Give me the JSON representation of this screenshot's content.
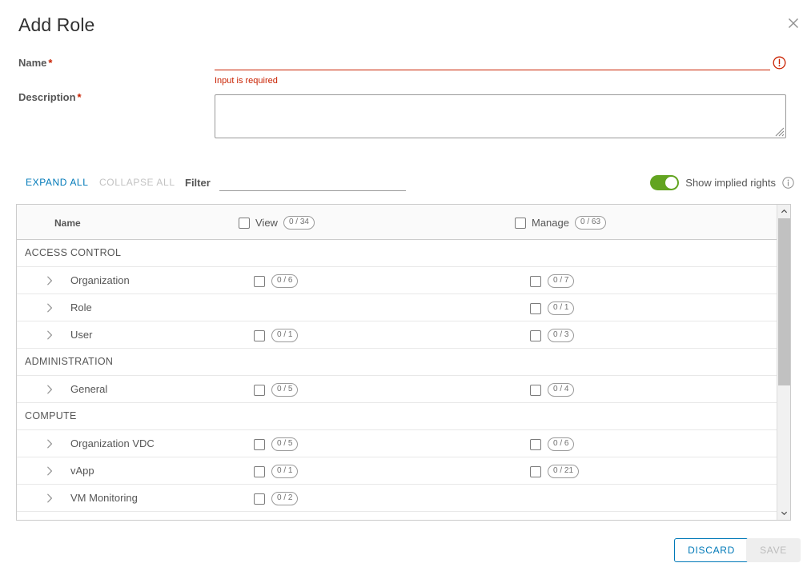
{
  "modal": {
    "title": "Add Role",
    "close_icon": "close-icon"
  },
  "form": {
    "name": {
      "label": "Name",
      "required_mark": "*",
      "value": "",
      "placeholder": "",
      "error_message": "Input is required",
      "error_icon": "exclamation-circle-icon",
      "error_color": "#c92100"
    },
    "description": {
      "label": "Description",
      "required_mark": "*",
      "value": "",
      "placeholder": ""
    }
  },
  "toolbar": {
    "expand_all_label": "EXPAND ALL",
    "collapse_all_label": "COLLAPSE ALL",
    "filter_label": "Filter",
    "filter_value": "",
    "filter_placeholder": "",
    "show_implied_rights_label": "Show implied rights",
    "show_implied_rights_on": true,
    "info_icon": "info-circle-icon",
    "link_color": "#0079b8",
    "disabled_color": "#c2c2c2",
    "toggle_on_color": "#62a420"
  },
  "rights_table": {
    "columns": {
      "name": "Name",
      "view": {
        "label": "View",
        "count": "0 / 34",
        "checked": false
      },
      "manage": {
        "label": "Manage",
        "count": "0 / 63",
        "checked": false
      }
    },
    "rows": [
      {
        "kind": "group",
        "label": "ACCESS CONTROL"
      },
      {
        "kind": "item",
        "label": "Organization",
        "view": {
          "has": true,
          "count": "0 / 6",
          "checked": false
        },
        "manage": {
          "has": true,
          "count": "0 / 7",
          "checked": false
        }
      },
      {
        "kind": "item",
        "label": "Role",
        "view": {
          "has": false
        },
        "manage": {
          "has": true,
          "count": "0 / 1",
          "checked": false
        }
      },
      {
        "kind": "item",
        "label": "User",
        "view": {
          "has": true,
          "count": "0 / 1",
          "checked": false
        },
        "manage": {
          "has": true,
          "count": "0 / 3",
          "checked": false
        }
      },
      {
        "kind": "group",
        "label": "ADMINISTRATION"
      },
      {
        "kind": "item",
        "label": "General",
        "view": {
          "has": true,
          "count": "0 / 5",
          "checked": false
        },
        "manage": {
          "has": true,
          "count": "0 / 4",
          "checked": false
        }
      },
      {
        "kind": "group",
        "label": "COMPUTE"
      },
      {
        "kind": "item",
        "label": "Organization VDC",
        "view": {
          "has": true,
          "count": "0 / 5",
          "checked": false
        },
        "manage": {
          "has": true,
          "count": "0 / 6",
          "checked": false
        }
      },
      {
        "kind": "item",
        "label": "vApp",
        "view": {
          "has": true,
          "count": "0 / 1",
          "checked": false
        },
        "manage": {
          "has": true,
          "count": "0 / 21",
          "checked": false
        }
      },
      {
        "kind": "item",
        "label": "VM Monitoring",
        "view": {
          "has": true,
          "count": "0 / 2",
          "checked": false
        },
        "manage": {
          "has": false
        }
      }
    ],
    "scroll": {
      "thumb_top_pct": 0,
      "thumb_height_pct": 58
    }
  },
  "footer": {
    "discard_label": "DISCARD",
    "save_label": "SAVE",
    "save_enabled": false
  }
}
